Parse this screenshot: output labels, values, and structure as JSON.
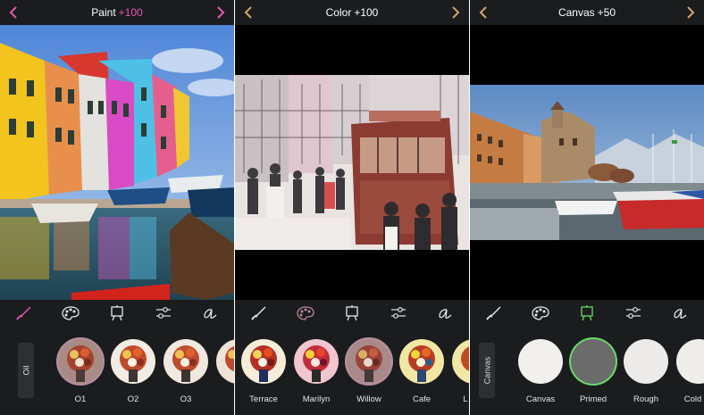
{
  "panels": [
    {
      "title": "Paint",
      "value": "+100",
      "value_color": "#e15bb4",
      "arrow_color": "#e15bb4",
      "category": "Oil",
      "tools": [
        "brush-icon",
        "palette-icon",
        "canvas-icon",
        "sliders-icon",
        "signature-icon"
      ],
      "thumbs": [
        {
          "label": "O1",
          "selected": true
        },
        {
          "label": "O2",
          "selected": false
        },
        {
          "label": "O3",
          "selected": false
        },
        {
          "label": "",
          "selected": false
        }
      ]
    },
    {
      "title": "Color",
      "value": "+100",
      "value_color": "#ffffff",
      "arrow_color": "#d8a36b",
      "tools": [
        "brush-icon",
        "palette-icon",
        "canvas-icon",
        "sliders-icon",
        "signature-icon"
      ],
      "thumbs": [
        {
          "label": "Terrace",
          "selected": false
        },
        {
          "label": "Marilyn",
          "selected": false
        },
        {
          "label": "Willow",
          "selected": true
        },
        {
          "label": "Cafe",
          "selected": false
        },
        {
          "label": "L",
          "selected": false
        }
      ]
    },
    {
      "title": "Canvas",
      "value": "+50",
      "value_color": "#ffffff",
      "arrow_color": "#d8a36b",
      "category": "Canvas",
      "tools": [
        "brush-icon",
        "palette-icon",
        "canvas-icon",
        "sliders-icon",
        "signature-icon"
      ],
      "thumbs": [
        {
          "label": "Canvas",
          "selected": false
        },
        {
          "label": "Primed",
          "selected": true
        },
        {
          "label": "Rough",
          "selected": false
        },
        {
          "label": "Cold P",
          "selected": false
        }
      ]
    }
  ],
  "colors": {
    "bar_bg": "#1b1c1e",
    "paint_accent": "#e15bb4",
    "canvas_accent": "#6ad86a",
    "arrow_orange": "#d8a36b"
  }
}
